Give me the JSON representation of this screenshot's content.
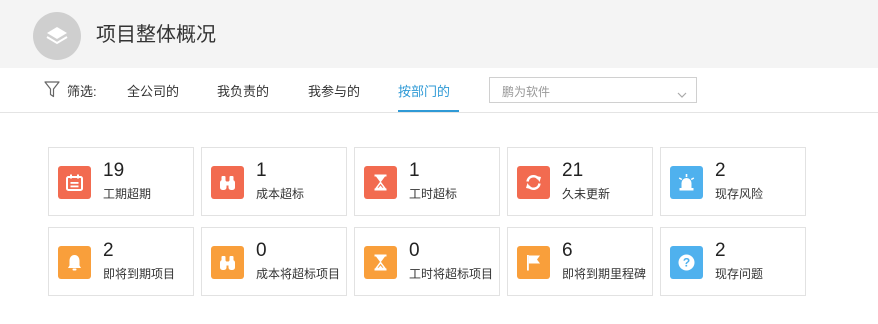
{
  "header": {
    "title": "项目整体概况",
    "logo_icon": "layers-icon"
  },
  "filter": {
    "label": "筛选:",
    "tabs": [
      {
        "label": "全公司的",
        "active": false
      },
      {
        "label": "我负责的",
        "active": false
      },
      {
        "label": "我参与的",
        "active": false
      },
      {
        "label": "按部门的",
        "active": true
      }
    ],
    "department_select": {
      "value": "鹏为软件"
    }
  },
  "colors": {
    "red": "#f26b50",
    "orange": "#f99f3b",
    "blue": "#4fb1ee",
    "accent": "#2f9ad6"
  },
  "stats": [
    {
      "value": "19",
      "label": "工期超期",
      "icon": "calendar-icon",
      "color": "red"
    },
    {
      "value": "1",
      "label": "成本超标",
      "icon": "binoculars-icon",
      "color": "red"
    },
    {
      "value": "1",
      "label": "工时超标",
      "icon": "hourglass-icon",
      "color": "red"
    },
    {
      "value": "21",
      "label": "久未更新",
      "icon": "refresh-icon",
      "color": "red"
    },
    {
      "value": "2",
      "label": "现存风险",
      "icon": "alarm-light-icon",
      "color": "blue"
    },
    {
      "value": "2",
      "label": "即将到期项目",
      "icon": "bell-icon",
      "color": "orange"
    },
    {
      "value": "0",
      "label": "成本将超标项目",
      "icon": "binoculars-icon",
      "color": "orange"
    },
    {
      "value": "0",
      "label": "工时将超标项目",
      "icon": "hourglass-icon",
      "color": "orange"
    },
    {
      "value": "6",
      "label": "即将到期里程碑",
      "icon": "flag-icon",
      "color": "orange"
    },
    {
      "value": "2",
      "label": "现存问题",
      "icon": "question-icon",
      "color": "blue"
    }
  ]
}
